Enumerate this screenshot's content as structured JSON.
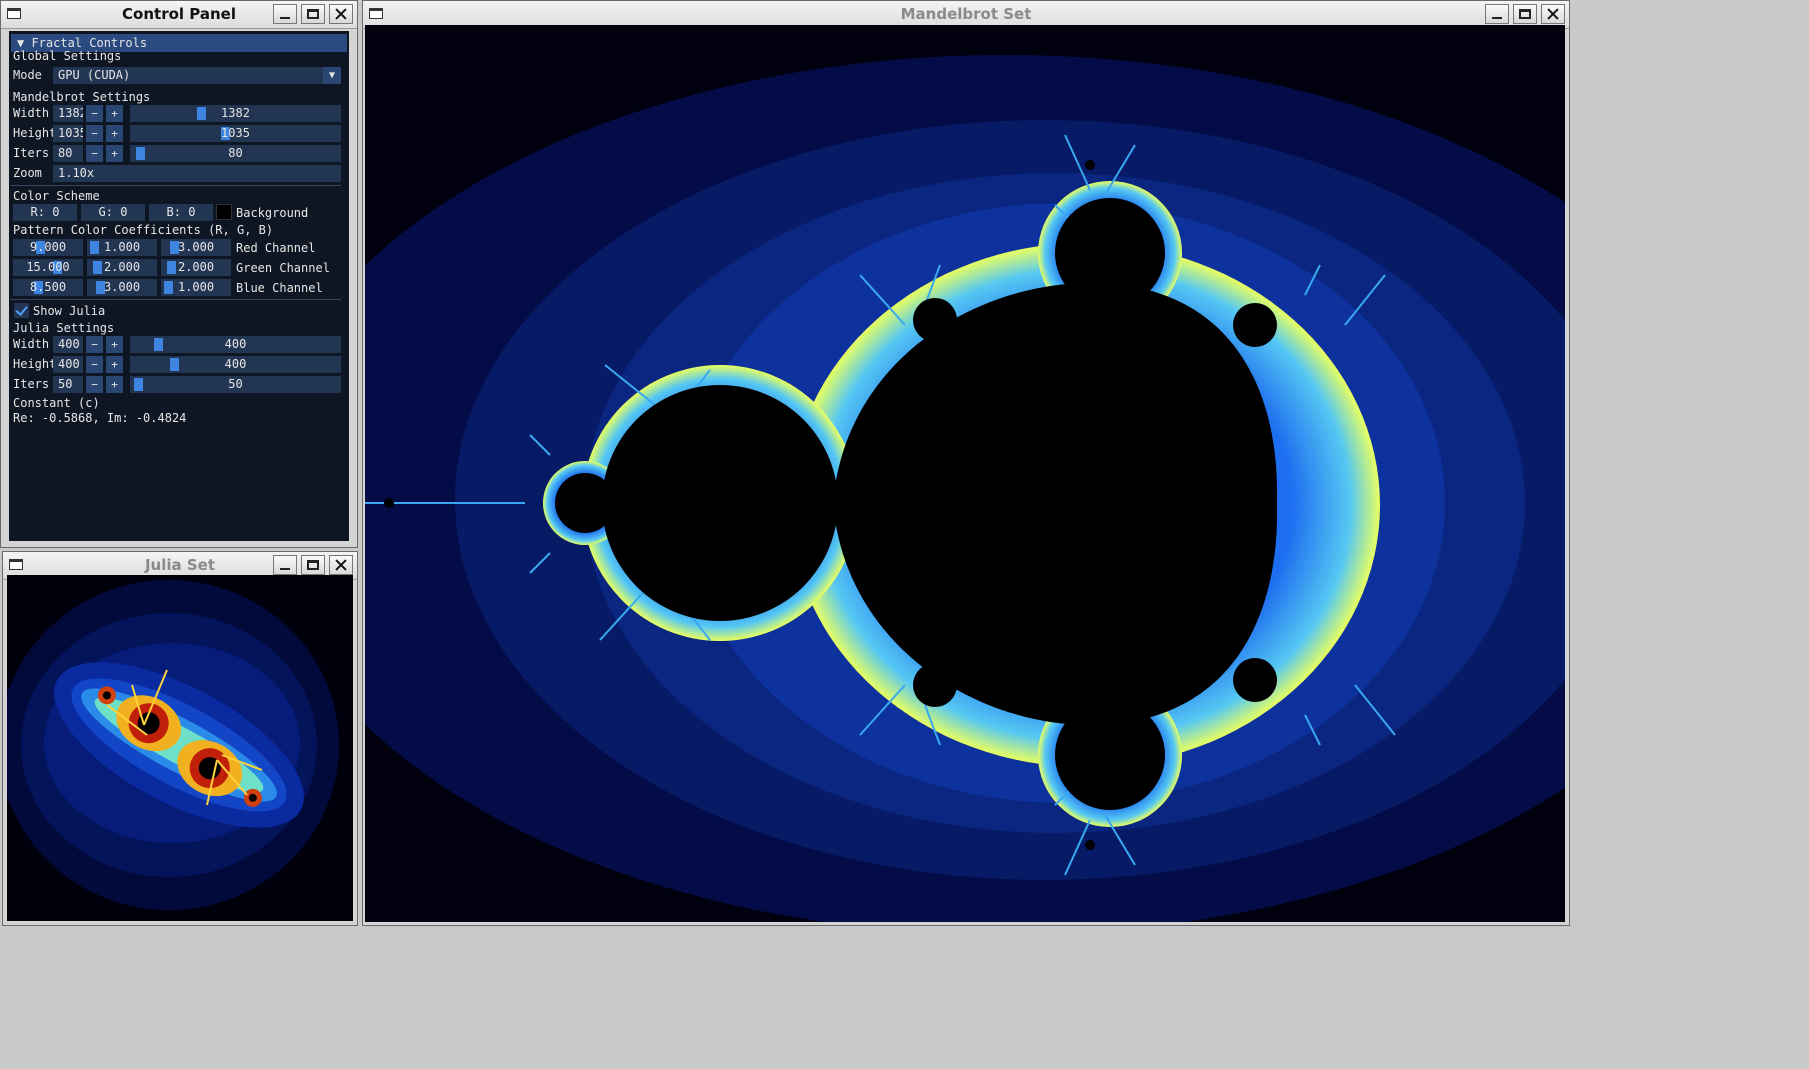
{
  "windows": {
    "control": {
      "title": "Control Panel"
    },
    "mandelbrot": {
      "title": "Mandelbrot Set"
    },
    "julia": {
      "title": "Julia Set"
    }
  },
  "panel": {
    "header": "▼ Fractal Controls",
    "global_settings": "Global Settings",
    "mode_label": "Mode",
    "mode_value": "GPU (CUDA)",
    "mandelbrot_settings": "Mandelbrot Settings",
    "mandel": {
      "width": {
        "label": "Width",
        "value": "1382",
        "slider": "1382",
        "fraction": 0.33
      },
      "height": {
        "label": "Height",
        "value": "1035",
        "slider": "1035",
        "fraction": 0.45
      },
      "iters": {
        "label": "Iters",
        "value": "80",
        "slider": "80",
        "fraction": 0.03
      },
      "zoom": {
        "label": "Zoom",
        "value": "1.10x"
      }
    },
    "color_scheme": "Color Scheme",
    "rgb": {
      "r": "R: 0",
      "g": "G: 0",
      "b": "B: 0",
      "background": "Background"
    },
    "pattern_title": "Pattern Color Coefficients (R, G, B)",
    "coeffs": [
      {
        "a": "9.000",
        "b": "1.000",
        "c": "3.000",
        "label": "Red Channel",
        "fa": 0.38,
        "fb": 0.05,
        "fc": 0.15
      },
      {
        "a": "15.000",
        "b": "2.000",
        "c": "2.000",
        "label": "Green Channel",
        "fa": 0.65,
        "fb": 0.1,
        "fc": 0.1
      },
      {
        "a": "8.500",
        "b": "3.000",
        "c": "1.000",
        "label": "Blue Channel",
        "fa": 0.35,
        "fb": 0.15,
        "fc": 0.05
      }
    ],
    "show_julia": "Show Julia",
    "julia_settings": "Julia Settings",
    "julia": {
      "width": {
        "label": "Width",
        "value": "400",
        "slider": "400",
        "fraction": 0.12
      },
      "height": {
        "label": "Height",
        "value": "400",
        "slider": "400",
        "fraction": 0.2
      },
      "iters": {
        "label": "Iters",
        "value": "50",
        "slider": "50",
        "fraction": 0.02
      }
    },
    "constant_label": "Constant (c)",
    "constant_value": "Re: -0.5868, Im: -0.4824",
    "minus": "−",
    "plus": "+"
  },
  "colors": {
    "panel_bg": "#0f1623",
    "accent": "#3d85e0",
    "header": "#2b4a80"
  }
}
